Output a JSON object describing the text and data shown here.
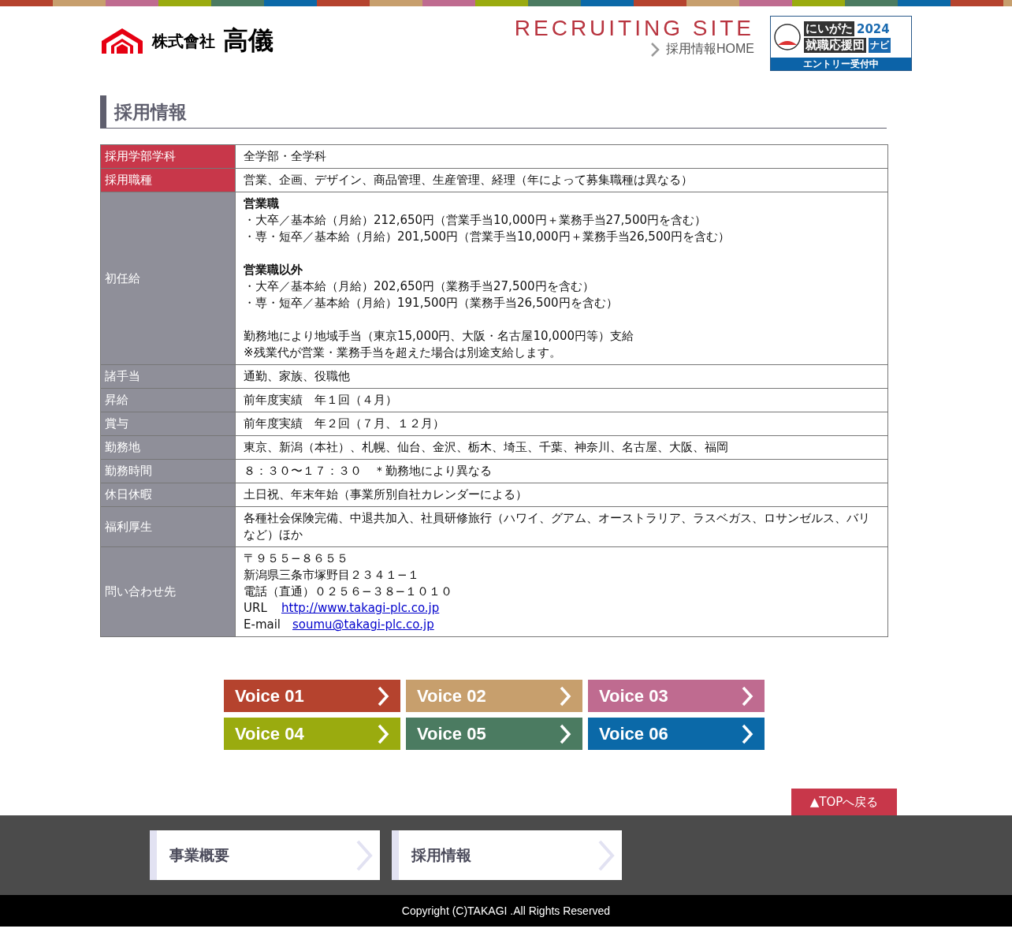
{
  "header": {
    "company_prefix": "株式會社",
    "company_name": "高儀",
    "site_title": "RECRUITING SITE",
    "home_link": "採用情報HOME",
    "banner": {
      "year": "2024",
      "line1": "にいがた",
      "line2": "就職応援団",
      "navi": "ナビ",
      "entry": "エントリー受付中"
    }
  },
  "section_title": "採用情報",
  "rows": [
    {
      "label": "採用学部学科",
      "highlighted": true,
      "paragraphs": [
        [
          "全学部・全学科"
        ]
      ]
    },
    {
      "label": "採用職種",
      "highlighted": true,
      "paragraphs": [
        [
          "営業、企画、デザイン、商品管理、生産管理、経理（年によって募集職種は異なる）"
        ]
      ]
    },
    {
      "label": "初任給",
      "highlighted": false,
      "paragraphs": [
        [
          "**営業職**",
          "・大卒／基本給（月給）212,650円（営業手当10,000円＋業務手当27,500円を含む）",
          "・専・短卒／基本給（月給）201,500円（営業手当10,000円＋業務手当26,500円を含む）"
        ],
        [
          "**営業職以外**",
          "・大卒／基本給（月給）202,650円（業務手当27,500円を含む）",
          "・専・短卒／基本給（月給）191,500円（業務手当26,500円を含む）"
        ],
        [
          "勤務地により地域手当（東京15,000円、大阪・名古屋10,000円等）支給",
          "※残業代が営業・業務手当を超えた場合は別途支給します。"
        ]
      ]
    },
    {
      "label": "諸手当",
      "highlighted": false,
      "paragraphs": [
        [
          "通勤、家族、役職他"
        ]
      ]
    },
    {
      "label": "昇給",
      "highlighted": false,
      "paragraphs": [
        [
          "前年度実績　年１回（４月）"
        ]
      ]
    },
    {
      "label": "賞与",
      "highlighted": false,
      "paragraphs": [
        [
          "前年度実績　年２回（７月、１２月）"
        ]
      ]
    },
    {
      "label": "勤務地",
      "highlighted": false,
      "paragraphs": [
        [
          "東京、新潟（本社）、札幌、仙台、金沢、栃木、埼玉、千葉、神奈川、名古屋、大阪、福岡"
        ]
      ]
    },
    {
      "label": "勤務時間",
      "highlighted": false,
      "paragraphs": [
        [
          "８：３０〜１７：３０　＊勤務地により異なる"
        ]
      ]
    },
    {
      "label": "休日休暇",
      "highlighted": false,
      "paragraphs": [
        [
          "土日祝、年末年始（事業所別自社カレンダーによる）"
        ]
      ]
    },
    {
      "label": "福利厚生",
      "highlighted": false,
      "paragraphs": [
        [
          "各種社会保険完備、中退共加入、社員研修旅行（ハワイ、グアム、オーストラリア、ラスベガス、ロサンゼルス、バリなど）ほか"
        ]
      ]
    },
    {
      "label": "問い合わせ先",
      "highlighted": false,
      "paragraphs": [
        [
          "〒９５５−８６５５",
          "新潟県三条市塚野目２３４１−１",
          "電話（直通）０２５６−３８−１０１０",
          {
            "label": "URL",
            "link": "http://www.takagi-plc.co.jp"
          },
          {
            "label": "E-mail",
            "link": "soumu@takagi-plc.co.jp"
          }
        ]
      ]
    }
  ],
  "voices": [
    {
      "label": "Voice 01",
      "color": "#b5432e"
    },
    {
      "label": "Voice 02",
      "color": "#c79f6d"
    },
    {
      "label": "Voice 03",
      "color": "#bf6b90"
    },
    {
      "label": "Voice 04",
      "color": "#9aab0f"
    },
    {
      "label": "Voice 05",
      "color": "#4b7b61"
    },
    {
      "label": "Voice 06",
      "color": "#0b69a8"
    }
  ],
  "top_button": "▲TOPへ戻る",
  "footer_links": [
    "事業概要",
    "採用情報"
  ],
  "copyright": "Copyright (C)TAKAGI .All Rights Reserved"
}
